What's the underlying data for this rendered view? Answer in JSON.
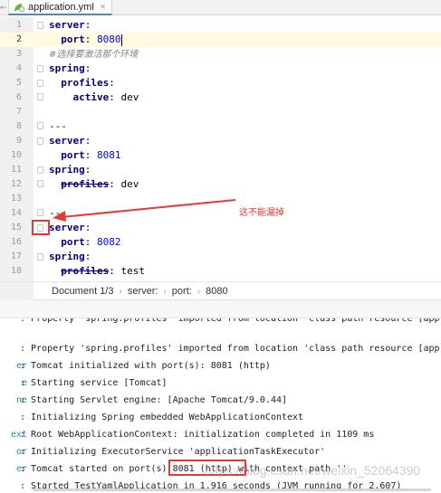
{
  "tab": {
    "label": "application.yml",
    "close": "×",
    "left_stub": "←"
  },
  "editor": {
    "lines": [
      {
        "num": "1",
        "key": "server",
        "sep": ":",
        "value": "",
        "indent": ""
      },
      {
        "num": "2",
        "key": "port",
        "sep": ":",
        "value": "8080",
        "indent": "  "
      },
      {
        "num": "3",
        "comment": "#选择要激活那个环境"
      },
      {
        "num": "4",
        "key": "spring",
        "sep": ":",
        "indent": ""
      },
      {
        "num": "5",
        "key": "profiles",
        "sep": ":",
        "indent": "  "
      },
      {
        "num": "6",
        "key": "active",
        "sep": ":",
        "value": "dev",
        "indent": "    "
      },
      {
        "num": "7"
      },
      {
        "num": "8",
        "plain": "---"
      },
      {
        "num": "9",
        "key": "server",
        "sep": ":"
      },
      {
        "num": "10",
        "key": "port",
        "sep": ":",
        "value": "8081",
        "indent": "  "
      },
      {
        "num": "11",
        "key": "spring",
        "sep": ":"
      },
      {
        "num": "12",
        "key": "profiles",
        "sep": ":",
        "value": "dev",
        "indent": "  "
      },
      {
        "num": "13"
      },
      {
        "num": "14",
        "plain": "---"
      },
      {
        "num": "15",
        "key": "server",
        "sep": ":"
      },
      {
        "num": "16",
        "key": "port",
        "sep": ":",
        "value": "8082",
        "indent": "  "
      },
      {
        "num": "17",
        "key": "spring",
        "sep": ":"
      },
      {
        "num": "18",
        "key": "profiles",
        "sep": ":",
        "value": "test",
        "indent": "  "
      }
    ],
    "annotation": "这不能漏掉"
  },
  "breadcrumb": [
    "Document 1/3",
    "server:",
    "port:",
    "8080"
  ],
  "console": {
    "lines": [
      {
        "cls": "",
        "msg": ": Property 'spring.profiles' imported from location 'class path resource [app"
      },
      {
        "cls": "",
        "msg": ": Property 'spring.profiles' imported from location 'class path resource [app"
      },
      {
        "cls": "er",
        "msg": ": Tomcat initialized with port(s): 8081 (http)"
      },
      {
        "cls": "e",
        "msg": ": Starting service [Tomcat]"
      },
      {
        "cls": "ne",
        "msg": ": Starting Servlet engine: [Apache Tomcat/9.0.44]"
      },
      {
        "cls": "",
        "msg": ": Initializing Spring embedded WebApplicationContext"
      },
      {
        "cls": "ext",
        "msg": ": Root WebApplicationContext: initialization completed in 1109 ms"
      },
      {
        "cls": "or",
        "msg": ": Initializing ExecutorService 'applicationTaskExecutor'"
      },
      {
        "cls": "er",
        "msg": ": Tomcat started on port(s) 8081 (http) with context path ''"
      },
      {
        "cls": "",
        "msg": ": Started TestYamlApplication in 1.916 seconds (JVM running for 2.607)"
      }
    ]
  },
  "watermark": "https://blog.csdn.net/weixin_52064390",
  "colors": {
    "accent": "#e53935",
    "keyword": "#000080",
    "number": "#0000ff",
    "comment": "#808080"
  }
}
